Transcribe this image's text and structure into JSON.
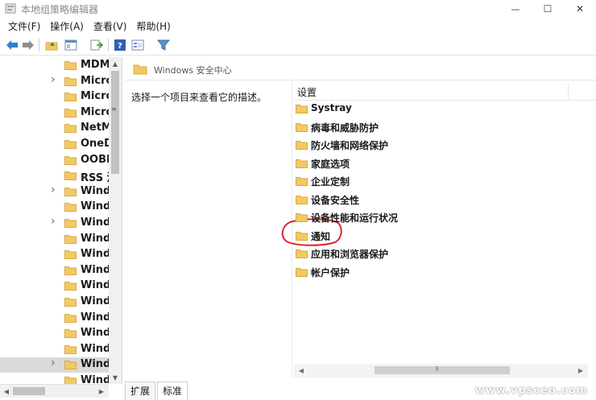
{
  "window": {
    "title": "本地组策略编辑器",
    "controls": {
      "minimize": "—",
      "maximize": "☐",
      "close": "✕"
    }
  },
  "menu": [
    "文件(F)",
    "操作(A)",
    "查看(V)",
    "帮助(H)"
  ],
  "toolbar": {
    "icons": [
      "back-arrow-icon",
      "forward-arrow-icon",
      "up-folder-icon",
      "show-hide-tree-icon",
      "export-list-icon",
      "help-icon",
      "properties-icon",
      "filter-icon"
    ]
  },
  "tree": {
    "items": [
      {
        "label": "MDM",
        "expandable": false
      },
      {
        "label": "Micro",
        "expandable": true
      },
      {
        "label": "Micro",
        "expandable": false
      },
      {
        "label": "Micro",
        "expandable": false
      },
      {
        "label": "NetM",
        "expandable": false
      },
      {
        "label": "OneD",
        "expandable": false
      },
      {
        "label": "OOBE",
        "expandable": false
      },
      {
        "label": "RSS 源",
        "expandable": false
      },
      {
        "label": "Wind",
        "expandable": true
      },
      {
        "label": "Wind",
        "expandable": false
      },
      {
        "label": "Wind",
        "expandable": true
      },
      {
        "label": "Wind",
        "expandable": false
      },
      {
        "label": "Wind",
        "expandable": false
      },
      {
        "label": "Wind",
        "expandable": false
      },
      {
        "label": "Wind",
        "expandable": false
      },
      {
        "label": "Wind",
        "expandable": false
      },
      {
        "label": "Wind",
        "expandable": false
      },
      {
        "label": "Wind",
        "expandable": false
      },
      {
        "label": "Wind",
        "expandable": false
      },
      {
        "label": "Wind",
        "expandable": true,
        "selected": true
      },
      {
        "label": "Wind",
        "expandable": false
      }
    ]
  },
  "breadcrumb": {
    "label": "Windows 安全中心"
  },
  "description": "选择一个项目来查看它的描述。",
  "list": {
    "header": "设置",
    "items": [
      "Systray",
      "病毒和威胁防护",
      "防火墙和网络保护",
      "家庭选项",
      "企业定制",
      "设备安全性",
      "设备性能和运行状况",
      "通知",
      "应用和浏览器保护",
      "帐户保护"
    ],
    "highlighted": "通知"
  },
  "tabs": [
    "扩展",
    "标准"
  ],
  "active_tab": "标准",
  "watermark": "www.vpsceo.com",
  "colors": {
    "folder": "#f3c966",
    "folder_edge": "#d9a93a",
    "annotation": "#d8262c",
    "back_arrow": "#2a7fd4"
  }
}
